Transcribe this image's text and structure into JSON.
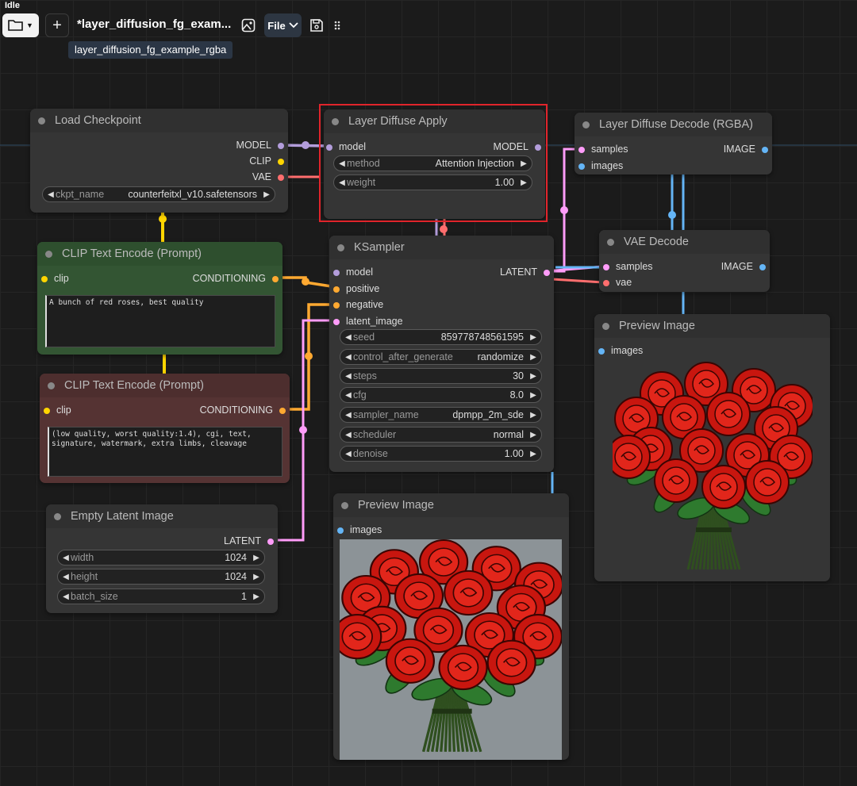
{
  "status": "Idle",
  "toolbar": {
    "workflow_title": "*layer_diffusion_fg_exam...",
    "file_label": "File",
    "tooltip": "layer_diffusion_fg_example_rgba"
  },
  "colors": {
    "model": "#b39ddb",
    "clip": "#ffd500",
    "vae": "#ff6e6e",
    "conditioning": "#ffa931",
    "latent": "#ff9cf9",
    "image": "#64b5f6",
    "highlight": "#e0242b"
  },
  "nodes": {
    "load_checkpoint": {
      "title": "Load Checkpoint",
      "outputs": [
        "MODEL",
        "CLIP",
        "VAE"
      ],
      "widgets": [
        {
          "label": "ckpt_name",
          "value": "counterfeitxl_v10.safetensors"
        }
      ]
    },
    "layer_diffuse_apply": {
      "title": "Layer Diffuse Apply",
      "input": "model",
      "output": "MODEL",
      "widgets": [
        {
          "label": "method",
          "value": "Attention Injection"
        },
        {
          "label": "weight",
          "value": "1.00"
        }
      ]
    },
    "layer_diffuse_decode": {
      "title": "Layer Diffuse Decode (RGBA)",
      "inputs": [
        "samples",
        "images"
      ],
      "output": "IMAGE"
    },
    "clip_positive": {
      "title": "CLIP Text Encode (Prompt)",
      "input": "clip",
      "output": "CONDITIONING",
      "text": "A bunch of red roses, best quality"
    },
    "clip_negative": {
      "title": "CLIP Text Encode (Prompt)",
      "input": "clip",
      "output": "CONDITIONING",
      "text": "(low quality, worst quality:1.4), cgi,  text, signature, watermark, extra limbs, cleavage"
    },
    "ksampler": {
      "title": "KSampler",
      "inputs": [
        "model",
        "positive",
        "negative",
        "latent_image"
      ],
      "output": "LATENT",
      "widgets": [
        {
          "label": "seed",
          "value": "859778748561595"
        },
        {
          "label": "control_after_generate",
          "value": "randomize"
        },
        {
          "label": "steps",
          "value": "30"
        },
        {
          "label": "cfg",
          "value": "8.0"
        },
        {
          "label": "sampler_name",
          "value": "dpmpp_2m_sde"
        },
        {
          "label": "scheduler",
          "value": "normal"
        },
        {
          "label": "denoise",
          "value": "1.00"
        }
      ]
    },
    "vae_decode": {
      "title": "VAE Decode",
      "inputs": [
        "samples",
        "vae"
      ],
      "output": "IMAGE"
    },
    "preview_right": {
      "title": "Preview Image",
      "input": "images"
    },
    "preview_bottom": {
      "title": "Preview Image",
      "input": "images"
    },
    "empty_latent": {
      "title": "Empty Latent Image",
      "output": "LATENT",
      "widgets": [
        {
          "label": "width",
          "value": "1024"
        },
        {
          "label": "height",
          "value": "1024"
        },
        {
          "label": "batch_size",
          "value": "1"
        }
      ]
    }
  }
}
